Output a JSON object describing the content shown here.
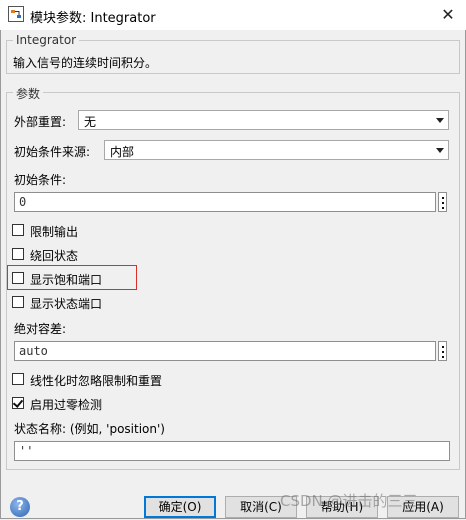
{
  "window": {
    "title": "模块参数: Integrator",
    "close_glyph": "✕"
  },
  "description_group": {
    "title": "Integrator",
    "text": "输入信号的连续时间积分。"
  },
  "params_group": {
    "title": "参数",
    "external_reset": {
      "label": "外部重置:",
      "value": "无"
    },
    "initial_source": {
      "label": "初始条件来源:",
      "value": "内部"
    },
    "initial_condition": {
      "label": "初始条件:",
      "value": "0"
    },
    "limit_output": {
      "label": "限制输出",
      "checked": false
    },
    "wrap_state": {
      "label": "绕回状态",
      "checked": false
    },
    "show_saturation_port": {
      "label": "显示饱和端口",
      "checked": false
    },
    "show_state_port": {
      "label": "显示状态端口",
      "checked": false
    },
    "abs_tolerance": {
      "label": "绝对容差:",
      "value": "auto"
    },
    "ignore_limit_linearize": {
      "label": "线性化时忽略限制和重置",
      "checked": false
    },
    "zero_crossing": {
      "label": "启用过零检测",
      "checked": true
    },
    "state_name": {
      "label": "状态名称: (例如, 'position')",
      "value": "''"
    }
  },
  "buttons": {
    "ok": "确定(O)",
    "cancel": "取消(C)",
    "help": "帮助(H)",
    "apply": "应用(A)",
    "help_icon": "?"
  },
  "watermark": "CSDN @进击的三三",
  "colors": {
    "highlight": "#d9302a",
    "default_button": "#0078d7"
  }
}
